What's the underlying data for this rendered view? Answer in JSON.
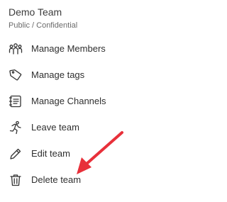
{
  "team": {
    "name": "Demo Team",
    "subtitle": "Public / Confidential"
  },
  "menu": {
    "items": [
      {
        "label": "Manage Members",
        "icon": "members-icon"
      },
      {
        "label": "Manage tags",
        "icon": "tag-icon"
      },
      {
        "label": "Manage Channels",
        "icon": "channels-icon"
      },
      {
        "label": "Leave team",
        "icon": "leave-icon"
      },
      {
        "label": "Edit team",
        "icon": "pencil-icon"
      },
      {
        "label": "Delete team",
        "icon": "trash-icon"
      }
    ]
  },
  "annotation": {
    "arrow_color": "#e8303a"
  }
}
